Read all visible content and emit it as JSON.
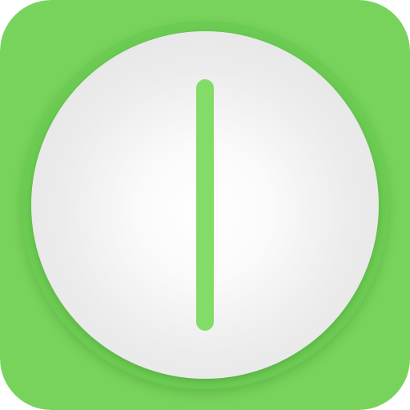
{
  "icon": {
    "name": "power-toggle-app-icon",
    "glyph": "power-line-icon",
    "colors": {
      "background": "#78D35C",
      "ring": "#6CCB52",
      "dial_center": "#FFFFFF",
      "dial_edge": "#E7E7E7",
      "indicator": "#84DC68"
    }
  }
}
